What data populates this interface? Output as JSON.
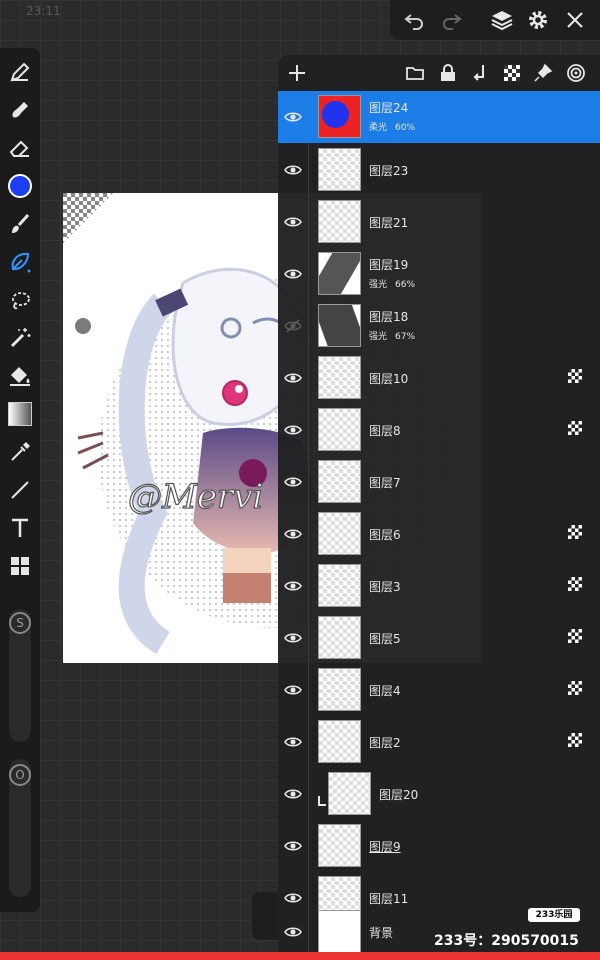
{
  "status": {
    "time": "23:11",
    "right": ""
  },
  "toolbar": {
    "undo": "undo-icon",
    "redo": "redo-icon",
    "layers": "layers-icon",
    "settings": "gear-icon",
    "close": "close-icon"
  },
  "tools": [
    "brush-icon",
    "smudge-icon",
    "eraser-icon",
    "color-swatch",
    "paint-brush-icon",
    "lasso-pen-icon",
    "lasso-icon",
    "magic-wand-icon",
    "fill-bucket-icon",
    "gradient-icon",
    "eyedropper-icon",
    "line-icon",
    "text-icon",
    "grid-icon"
  ],
  "current_color": "#1e3ff0",
  "sliders": {
    "size_label": "S",
    "opacity_label": "O"
  },
  "layers_header": [
    "add-icon",
    "folder-icon",
    "lock-icon",
    "merge-down-icon",
    "checker-icon",
    "pin-icon",
    "target-icon"
  ],
  "layers": [
    {
      "name": "图层24",
      "mode": "柔光",
      "opacity": "60%",
      "selected": true,
      "visible": true,
      "alpha_lock": false,
      "thumb": "blue-red"
    },
    {
      "name": "图层23",
      "mode": "",
      "opacity": "",
      "selected": false,
      "visible": true,
      "alpha_lock": false,
      "thumb": "sketch"
    },
    {
      "name": "图层21",
      "mode": "",
      "opacity": "",
      "selected": false,
      "visible": true,
      "alpha_lock": false,
      "thumb": "lines"
    },
    {
      "name": "图层19",
      "mode": "强光",
      "opacity": "66%",
      "selected": false,
      "visible": true,
      "alpha_lock": false,
      "thumb": "dark"
    },
    {
      "name": "图层18",
      "mode": "强光",
      "opacity": "67%",
      "selected": false,
      "visible": false,
      "alpha_lock": false,
      "thumb": "dark2"
    },
    {
      "name": "图层10",
      "mode": "",
      "opacity": "",
      "selected": false,
      "visible": true,
      "alpha_lock": true,
      "thumb": "empty"
    },
    {
      "name": "图层8",
      "mode": "",
      "opacity": "",
      "selected": false,
      "visible": true,
      "alpha_lock": true,
      "thumb": "empty"
    },
    {
      "name": "图层7",
      "mode": "",
      "opacity": "",
      "selected": false,
      "visible": true,
      "alpha_lock": false,
      "thumb": "pink"
    },
    {
      "name": "图层6",
      "mode": "",
      "opacity": "",
      "selected": false,
      "visible": true,
      "alpha_lock": true,
      "thumb": "sketch"
    },
    {
      "name": "图层3",
      "mode": "",
      "opacity": "",
      "selected": false,
      "visible": true,
      "alpha_lock": true,
      "thumb": "sketch"
    },
    {
      "name": "图层5",
      "mode": "",
      "opacity": "",
      "selected": false,
      "visible": true,
      "alpha_lock": true,
      "thumb": "lines"
    },
    {
      "name": "图层4",
      "mode": "",
      "opacity": "",
      "selected": false,
      "visible": true,
      "alpha_lock": true,
      "thumb": "empty"
    },
    {
      "name": "图层2",
      "mode": "",
      "opacity": "",
      "selected": false,
      "visible": true,
      "alpha_lock": true,
      "thumb": "sketch"
    },
    {
      "name": "图层20",
      "mode": "",
      "opacity": "",
      "selected": false,
      "visible": true,
      "alpha_lock": false,
      "thumb": "empty",
      "clipped": true
    },
    {
      "name": "图层9",
      "mode": "",
      "opacity": "",
      "selected": false,
      "visible": true,
      "alpha_lock": false,
      "thumb": "empty",
      "underline": true
    },
    {
      "name": "图层11",
      "mode": "",
      "opacity": "",
      "selected": false,
      "visible": true,
      "alpha_lock": false,
      "thumb": "sketch"
    },
    {
      "name": "背景",
      "mode": "",
      "opacity": "",
      "selected": false,
      "visible": true,
      "alpha_lock": false,
      "thumb": "white"
    }
  ],
  "watermark": {
    "badge": "233乐园",
    "id": "233号：290570015"
  },
  "canvas_text": "@Mervi"
}
